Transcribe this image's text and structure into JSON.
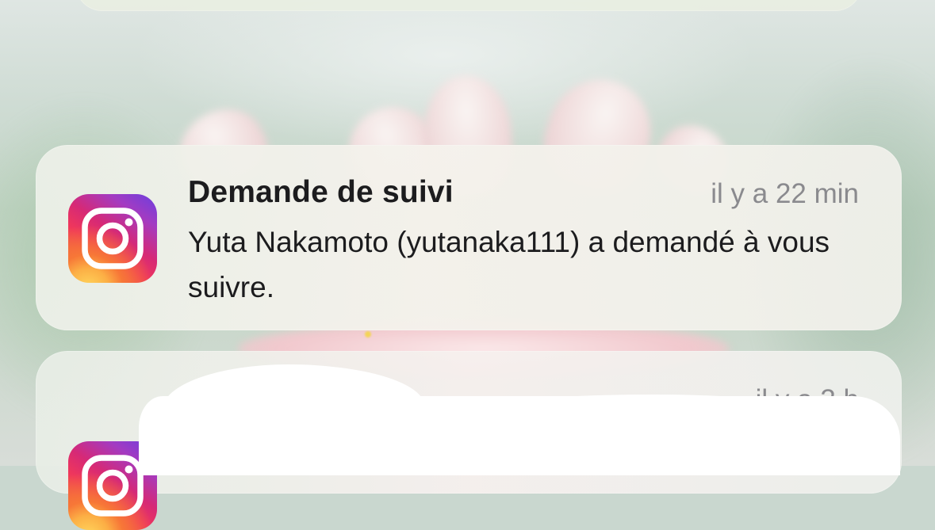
{
  "notifications": [
    {
      "app_icon": "instagram-icon",
      "title": "Demande de suivi",
      "time": "il y a 22 min",
      "body": "Yuta Nakamoto (yutanaka111) a demandé à vous suivre."
    },
    {
      "app_icon": "instagram-icon",
      "title": "",
      "time": "il y a 3 h",
      "body": ""
    }
  ],
  "colors": {
    "title_text": "#1c1c1e",
    "time_text": "#8a8a8e",
    "card_background": "#eef0e8",
    "redaction": "#ffffff"
  }
}
